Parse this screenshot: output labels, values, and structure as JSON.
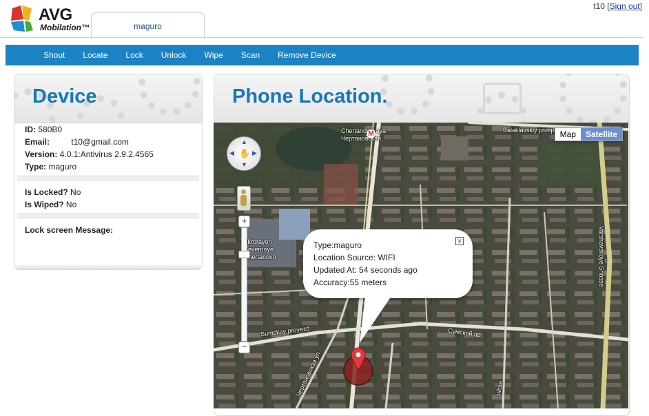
{
  "header": {
    "logo_brand": "AVG",
    "logo_product": "Mobilation™",
    "active_tab": "maguro",
    "username": "t10",
    "signout_label": "Sign out"
  },
  "nav": {
    "items": [
      "Shout",
      "Locate",
      "Lock",
      "Unlock",
      "Wipe",
      "Scan",
      "Remove Device"
    ]
  },
  "device": {
    "title": "Device",
    "id_label": "ID:",
    "id_value": "580B0",
    "email_label": "Email:",
    "email_value": "t10@gmail.com",
    "version_label": "Version:",
    "version_value": "4.0.1:Antivirus 2.9.2.4565",
    "type_label": "Type:",
    "type_value": "maguro",
    "locked_label": "Is Locked?",
    "locked_value": "No",
    "wiped_label": "Is Wiped?",
    "wiped_value": "No",
    "lock_msg_label": "Lock screen Message:"
  },
  "location": {
    "title": "Phone Location.",
    "map_button": "Map",
    "satellite_button": "Satellite",
    "bubble": {
      "type": "Type:maguro",
      "source": "Location Source: WIFI",
      "updated": "Updated At: 54 seconds ago",
      "accuracy": "Accuracy:55 meters"
    },
    "labels": {
      "metro_en": "Chertanovskaya",
      "metro_ru": "Чертановская",
      "balaklavsky": "Balaklavskiy prosp",
      "mikro1": "mikrorayon",
      "mikro2": "Severnoye",
      "mikro3": "Chertanovo",
      "sumskoy": "Sumskoy proyezd",
      "sumskoy_ru": "Сумской пр",
      "varshavskoye": "Varshavskoye Shosse",
      "chertan_ru": "Чертановская ул",
      "ulitsa": "ulitsa"
    }
  },
  "colors": {
    "nav_bg": "#1b82c4",
    "title_blue": "#1578b8",
    "satellite_active": "#6c8fcf"
  }
}
